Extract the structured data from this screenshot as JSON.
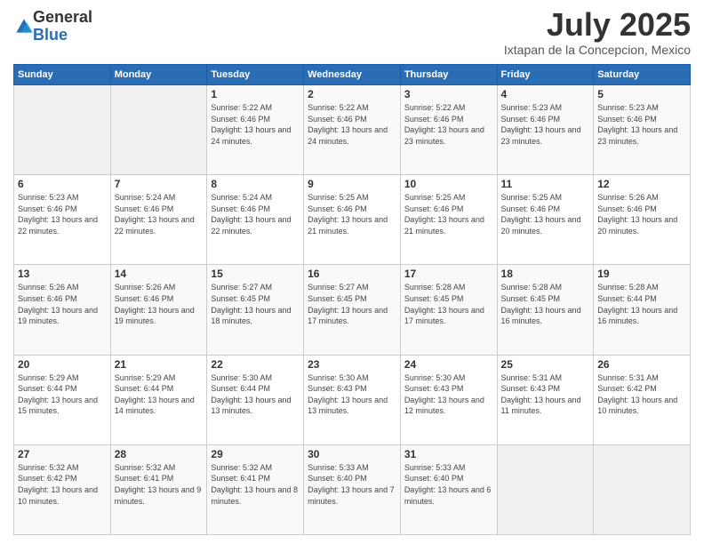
{
  "logo": {
    "general": "General",
    "blue": "Blue"
  },
  "title": "July 2025",
  "subtitle": "Ixtapan de la Concepcion, Mexico",
  "days": [
    "Sunday",
    "Monday",
    "Tuesday",
    "Wednesday",
    "Thursday",
    "Friday",
    "Saturday"
  ],
  "weeks": [
    [
      {
        "day": "",
        "content": ""
      },
      {
        "day": "",
        "content": ""
      },
      {
        "day": "1",
        "content": "Sunrise: 5:22 AM\nSunset: 6:46 PM\nDaylight: 13 hours and 24 minutes."
      },
      {
        "day": "2",
        "content": "Sunrise: 5:22 AM\nSunset: 6:46 PM\nDaylight: 13 hours and 24 minutes."
      },
      {
        "day": "3",
        "content": "Sunrise: 5:22 AM\nSunset: 6:46 PM\nDaylight: 13 hours and 23 minutes."
      },
      {
        "day": "4",
        "content": "Sunrise: 5:23 AM\nSunset: 6:46 PM\nDaylight: 13 hours and 23 minutes."
      },
      {
        "day": "5",
        "content": "Sunrise: 5:23 AM\nSunset: 6:46 PM\nDaylight: 13 hours and 23 minutes."
      }
    ],
    [
      {
        "day": "6",
        "content": "Sunrise: 5:23 AM\nSunset: 6:46 PM\nDaylight: 13 hours and 22 minutes."
      },
      {
        "day": "7",
        "content": "Sunrise: 5:24 AM\nSunset: 6:46 PM\nDaylight: 13 hours and 22 minutes."
      },
      {
        "day": "8",
        "content": "Sunrise: 5:24 AM\nSunset: 6:46 PM\nDaylight: 13 hours and 22 minutes."
      },
      {
        "day": "9",
        "content": "Sunrise: 5:25 AM\nSunset: 6:46 PM\nDaylight: 13 hours and 21 minutes."
      },
      {
        "day": "10",
        "content": "Sunrise: 5:25 AM\nSunset: 6:46 PM\nDaylight: 13 hours and 21 minutes."
      },
      {
        "day": "11",
        "content": "Sunrise: 5:25 AM\nSunset: 6:46 PM\nDaylight: 13 hours and 20 minutes."
      },
      {
        "day": "12",
        "content": "Sunrise: 5:26 AM\nSunset: 6:46 PM\nDaylight: 13 hours and 20 minutes."
      }
    ],
    [
      {
        "day": "13",
        "content": "Sunrise: 5:26 AM\nSunset: 6:46 PM\nDaylight: 13 hours and 19 minutes."
      },
      {
        "day": "14",
        "content": "Sunrise: 5:26 AM\nSunset: 6:46 PM\nDaylight: 13 hours and 19 minutes."
      },
      {
        "day": "15",
        "content": "Sunrise: 5:27 AM\nSunset: 6:45 PM\nDaylight: 13 hours and 18 minutes."
      },
      {
        "day": "16",
        "content": "Sunrise: 5:27 AM\nSunset: 6:45 PM\nDaylight: 13 hours and 17 minutes."
      },
      {
        "day": "17",
        "content": "Sunrise: 5:28 AM\nSunset: 6:45 PM\nDaylight: 13 hours and 17 minutes."
      },
      {
        "day": "18",
        "content": "Sunrise: 5:28 AM\nSunset: 6:45 PM\nDaylight: 13 hours and 16 minutes."
      },
      {
        "day": "19",
        "content": "Sunrise: 5:28 AM\nSunset: 6:44 PM\nDaylight: 13 hours and 16 minutes."
      }
    ],
    [
      {
        "day": "20",
        "content": "Sunrise: 5:29 AM\nSunset: 6:44 PM\nDaylight: 13 hours and 15 minutes."
      },
      {
        "day": "21",
        "content": "Sunrise: 5:29 AM\nSunset: 6:44 PM\nDaylight: 13 hours and 14 minutes."
      },
      {
        "day": "22",
        "content": "Sunrise: 5:30 AM\nSunset: 6:44 PM\nDaylight: 13 hours and 13 minutes."
      },
      {
        "day": "23",
        "content": "Sunrise: 5:30 AM\nSunset: 6:43 PM\nDaylight: 13 hours and 13 minutes."
      },
      {
        "day": "24",
        "content": "Sunrise: 5:30 AM\nSunset: 6:43 PM\nDaylight: 13 hours and 12 minutes."
      },
      {
        "day": "25",
        "content": "Sunrise: 5:31 AM\nSunset: 6:43 PM\nDaylight: 13 hours and 11 minutes."
      },
      {
        "day": "26",
        "content": "Sunrise: 5:31 AM\nSunset: 6:42 PM\nDaylight: 13 hours and 10 minutes."
      }
    ],
    [
      {
        "day": "27",
        "content": "Sunrise: 5:32 AM\nSunset: 6:42 PM\nDaylight: 13 hours and 10 minutes."
      },
      {
        "day": "28",
        "content": "Sunrise: 5:32 AM\nSunset: 6:41 PM\nDaylight: 13 hours and 9 minutes."
      },
      {
        "day": "29",
        "content": "Sunrise: 5:32 AM\nSunset: 6:41 PM\nDaylight: 13 hours and 8 minutes."
      },
      {
        "day": "30",
        "content": "Sunrise: 5:33 AM\nSunset: 6:40 PM\nDaylight: 13 hours and 7 minutes."
      },
      {
        "day": "31",
        "content": "Sunrise: 5:33 AM\nSunset: 6:40 PM\nDaylight: 13 hours and 6 minutes."
      },
      {
        "day": "",
        "content": ""
      },
      {
        "day": "",
        "content": ""
      }
    ]
  ]
}
